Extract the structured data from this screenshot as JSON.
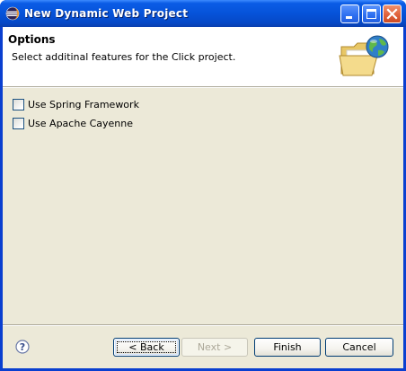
{
  "window": {
    "title": "New Dynamic Web Project"
  },
  "header": {
    "title": "Options",
    "description": "Select additinal features for the Click project."
  },
  "options": [
    {
      "label": "Use Spring Framework",
      "checked": false
    },
    {
      "label": "Use Apache Cayenne",
      "checked": false
    }
  ],
  "buttons": {
    "back": "< Back",
    "next": "Next >",
    "finish": "Finish",
    "cancel": "Cancel"
  },
  "colors": {
    "titlebar": "#0653d9",
    "dialog_background": "#ece9d8",
    "header_background": "#ffffff"
  },
  "icons": {
    "title": "eclipse-icon",
    "header": "folder-globe-icon",
    "help": "help-icon"
  }
}
